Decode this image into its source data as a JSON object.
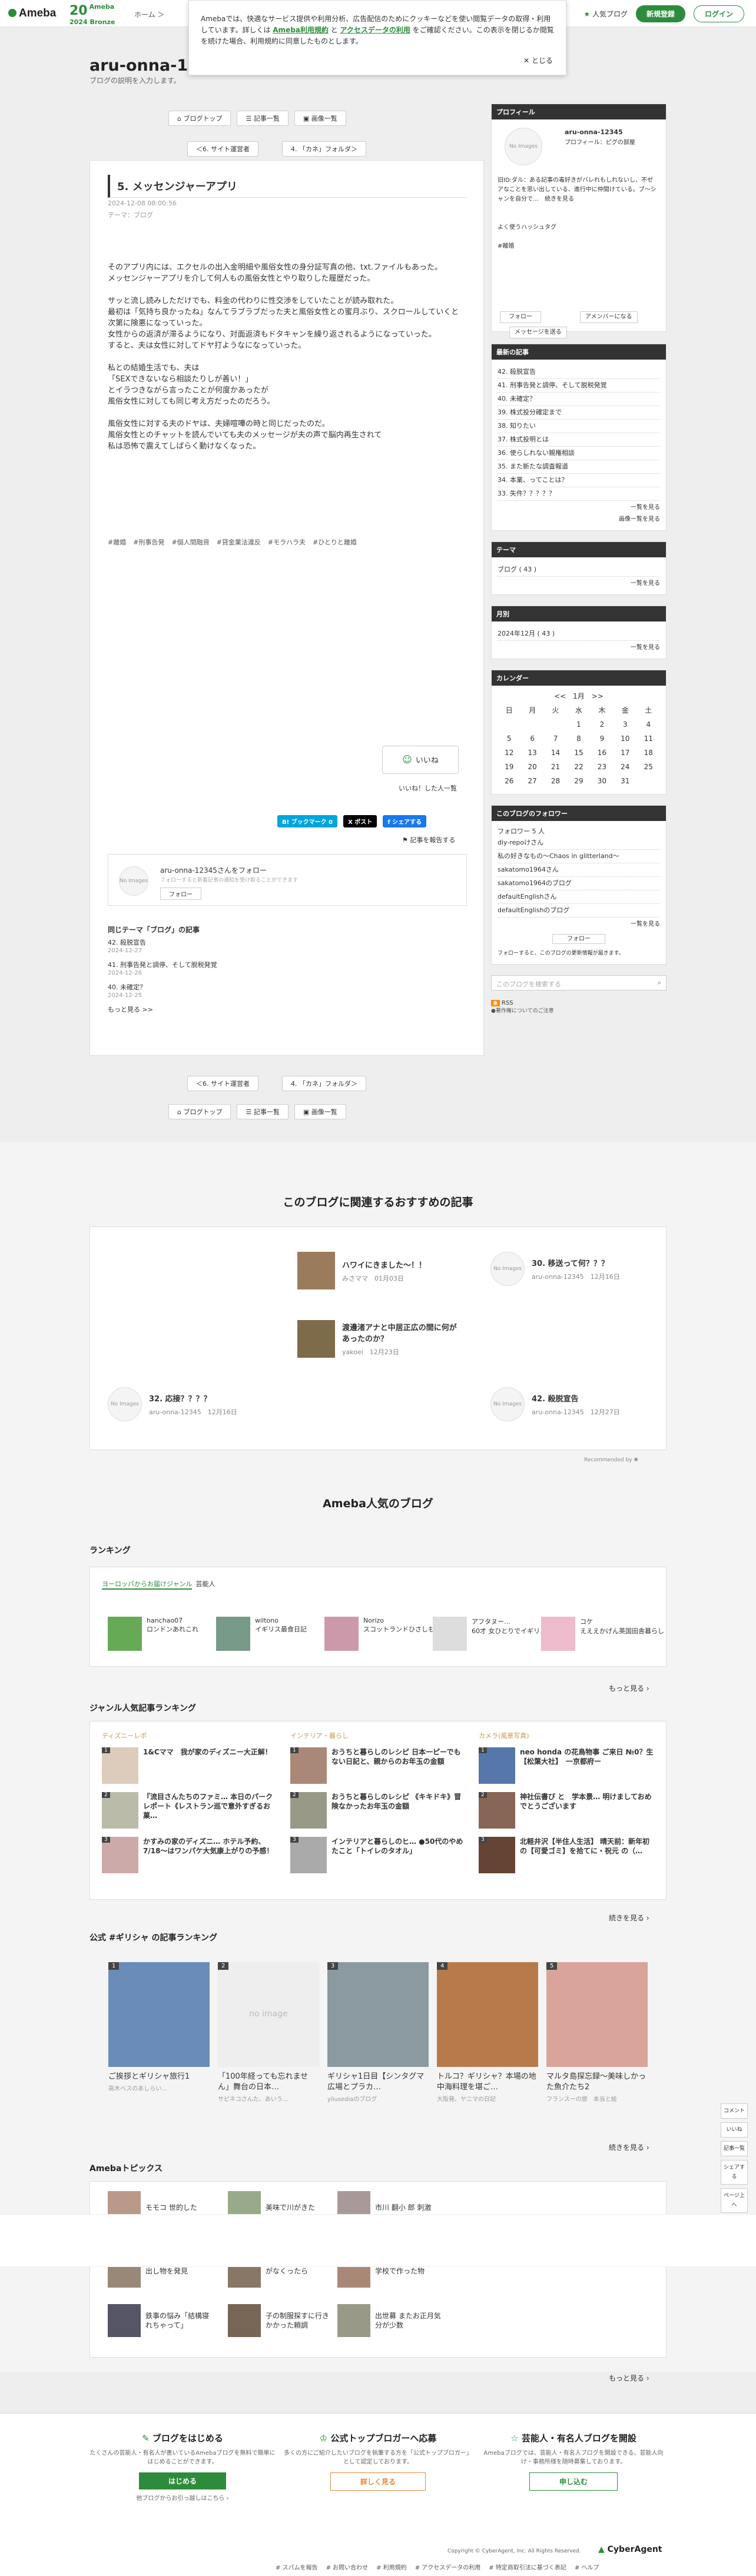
{
  "header": {
    "logo": "Ameba",
    "anniv_num": "20",
    "anniv_text": "Ameba\n2024 Bronze",
    "breadcrumb": "ホーム ＞",
    "popular": "人気ブログ",
    "signup": "新規登録",
    "login": "ログイン"
  },
  "cookie": {
    "text1": "Amebaでは、快適なサービス提供や利用分析、広告配信のためにクッキーなどを使い閲覧データの取得・利用しています。詳しくは ",
    "link1": "Ameba利用規約",
    "and": " と ",
    "link2": "アクセスデータの利用",
    "text2": " をご確認ください。この表示を閉じるか閲覧を続けた場合、利用規約に同意したものとします。",
    "close": "✕ とじる"
  },
  "blog": {
    "title": "aru-onna-12",
    "desc": "ブログの説明を入力します。"
  },
  "nav": {
    "top": "ブログトップ",
    "list": "記事一覧",
    "images": "画像一覧",
    "prev": "＜6. サイト運営者",
    "next": "4. 「カネ」フォルダ＞"
  },
  "entry": {
    "title": "5. メッセンジャーアプリ",
    "date": "2024-12-08 08:00:56",
    "theme": "テーマ：ブログ",
    "paras": [
      "そのアプリ内には、エクセルの出入金明細や風俗女性の身分証写真の他、txt.ファイルもあった。\nメッセンジャーアプリを介して何人もの風俗女性とやり取りした履歴だった。",
      "サッと流し読みしただけでも、料金の代わりに性交渉をしていたことが読み取れた。\n最初は「気持ち良かったね」なんてラブラブだった夫と風俗女性との蜜月ぶり、スクロールしていくと次第に険悪になっていった。\n女性からの返済が滞るようになり、対面返済もドタキャンを繰り返されるようになっていった。\nすると、夫は女性に対してドヤ打ようなになっていった。",
      "私との結婚生活でも、夫は\n「SEXできないなら相談たりしが善い！」\nとイラつきながら言ったことが何度かあったが\n風俗女性に対しても同じ考え方だったのだろう。",
      "風俗女性に対する夫のドヤは、夫婦喧嘩の時と同じだったのだ。\n風俗女性とのチャットを読んでいても夫のメッセージが夫の声で脳内再生されて\n私は恐怖で震えてしばらく動けなくなった。"
    ],
    "tags": [
      "#離婚",
      "#刑事告発",
      "#個人間融資",
      "#貸金業法違反",
      "#モラハラ夫",
      "#ひとりと離婚"
    ],
    "iine": "いいね",
    "iine_count": "いいね！した人一覧",
    "report": "記事を報告する",
    "share": {
      "hatena": "B! ブックマーク 0",
      "x": "X ポスト",
      "fb": "f シェアする"
    }
  },
  "follow": {
    "name": "aru-onna-12345さんをフォロー",
    "sub": "フォローすると新着記事の通知を受け取ることができます",
    "btn": "フォロー",
    "noimg": "No Images"
  },
  "same_theme": {
    "title": "同じテーマ「ブログ」の記事",
    "items": [
      {
        "t": "42. 殺脱宣告",
        "d": "2024-12-27"
      },
      {
        "t": "41. 刑事告発と調停、そして脱税発覚",
        "d": "2024-12-26"
      },
      {
        "t": "40. 未確定？",
        "d": "2024-12-25"
      }
    ],
    "more": "もっと見る >>"
  },
  "sidebar": {
    "profile": {
      "head": "プロフィール",
      "name": "aru-onna-12345",
      "sub": "プロフィール：ピグの部屋",
      "text": "旧ID:ダル：ある記事の毒好きがバレれもしれないし、不ゼアなことを思い出している、進行中に仲間けている。ブ～シャンを自分で…　続きを見る",
      "hashtag": "よく使うハッシュタグ",
      "tag": "#離婚",
      "follow": "フォロー",
      "member": "アメンバーになる",
      "message": "メッセージを送る"
    },
    "recent": {
      "head": "最新の記事",
      "items": [
        "42. 殺脱宣告",
        "41. 刑事告発と調停、そして脱税発覚",
        "40. 未確定？",
        "39. 株式投分確定まで",
        "38. 知りたい",
        "37. 株式投明とは",
        "36. 使らしれない親権相談",
        "35. また新たな調査報道",
        "34. 本業、ってことは？",
        "33. 失件？？？？？"
      ],
      "more": "一覧を見る",
      "img_more": "画像一覧を見る"
    },
    "theme": {
      "head": "テーマ",
      "item": "ブログ ( 43 )",
      "more": "一覧を見る"
    },
    "month": {
      "head": "月別",
      "item": "2024年12月 ( 43 )",
      "more": "一覧を見る"
    },
    "cal": {
      "head": "カレンダー",
      "nav": "<<　1月　>>",
      "days": [
        "日",
        "月",
        "火",
        "水",
        "木",
        "金",
        "土"
      ],
      "rows": [
        [
          "",
          "",
          "",
          "1",
          "2",
          "3",
          "4"
        ],
        [
          "5",
          "6",
          "7",
          "8",
          "9",
          "10",
          "11"
        ],
        [
          "12",
          "13",
          "14",
          "15",
          "16",
          "17",
          "18"
        ],
        [
          "19",
          "20",
          "21",
          "22",
          "23",
          "24",
          "25"
        ],
        [
          "26",
          "27",
          "28",
          "29",
          "30",
          "31",
          ""
        ]
      ]
    },
    "followers": {
      "head": "このブログのフォロワー",
      "count": "フォロワー 5 人",
      "items": [
        "diy-repoけさん",
        "私の好きなもの〜Chaos in glitterland〜",
        "sakatomo1964さん",
        "sakatomo1964のブログ",
        "defaultEnglishさん",
        "defaultEnglishのブログ"
      ],
      "more": "一覧を見る",
      "btn": "フォロー",
      "note": "フォローすると、このブログの更新情報が届きます。"
    },
    "search": "このブログを検索する",
    "rss": "RSS",
    "rss_note": "●著作権についてのご注意"
  },
  "recommend": {
    "title": "このブログに関連するおすすめの記事",
    "items": [
      {
        "t": "ハワイにきました〜！！",
        "m": "みさママ　01月03日"
      },
      {
        "t": "30. 移送って何？？？",
        "m": "aru-onna-12345　12月16日"
      },
      {
        "t": "渡邊渚アナと中居正広の間に何があったのか？",
        "m": "yakoei　12月23日"
      },
      {
        "t": "32. 応接？？？？",
        "m": "aru-onna-12345　12月16日"
      },
      {
        "t": "42. 殺脱宣告",
        "m": "aru-onna-12345　12月27日"
      }
    ],
    "by": "Recommended by"
  },
  "popular": {
    "title": "Ameba人気のブログ",
    "ranking": "ランキング",
    "genre_label": "ヨーロッパからお届けジャンル",
    "genre_tag": "芸能人",
    "rank": [
      {
        "n": "hanchao07",
        "t": "ロンドンあれこれ"
      },
      {
        "n": "wiltono",
        "t": "イギリス最食日記"
      },
      {
        "n": "Norizo",
        "t": "スコットランドひさしも日記"
      },
      {
        "n": "アフタヌー…",
        "t": "60才 女ひとりでイギリスに移住"
      },
      {
        "n": "コケ",
        "t": "えええかげん英国田舎暮らし"
      }
    ],
    "more": "もっと見る"
  },
  "genre": {
    "title": "ジャンル人気記事ランキング",
    "cols": [
      {
        "h": "ディズニーレポ",
        "items": [
          "1&Cママ　我が家のディズニー大正解！",
          "『流目さんたちのファミ… 本日のパークレポート《レストラン巡で意外すぎるお菓…",
          "かすみの家のディズニ… ホテル予約、7/18〜はワンパケ大気康上がりの予感！"
        ]
      },
      {
        "h": "インテリア・暮らし",
        "items": [
          "おうちと暮らしのレシピ 日本一ピーでもない日記と、親からのお年玉の金額",
          "おうちと暮らしのレシピ 《キキドキ》冒険なかったお年玉の金額",
          "インテリアと暮らしのヒ… ●50代のやめたこと「トイレのタオル」"
        ]
      },
      {
        "h": "カメラ(風景写真)",
        "items": [
          "neo honda の花鳥物事 ご来日 №0？生【松葉大社】　一京都府ー",
          "神社伝書び と　学本景… 明けましておめでとうございます",
          "北軽井沢【半住人生活】 晴天前：新年初の【可愛ゴミ】を拾てに・祝元 の（…"
        ]
      }
    ],
    "more": "続きを見る"
  },
  "official": {
    "title": "公式 #ギリシャ の記事ランキング",
    "cards": [
      {
        "t": "ご挨拶とギリシャ旅行1",
        "u": "高木ベスのあしらい..."
      },
      {
        "t": "「100年経っても忘れません」舞台の日本…",
        "u": "サビネコさんた、あいう..."
      },
      {
        "t": "ギリシャ1日目【シンタグマ広場とプラカ…",
        "u": "yliusediaのブログ"
      },
      {
        "t": "トルコ？ギリシャ？本場の地中海料理を堪ご…",
        "u": "大阪発、ヤニマの日記"
      },
      {
        "t": "マルタ島探忘録〜美味しかった魚介たち2",
        "u": "フランスーの旅　本当と絵"
      }
    ],
    "noimg": "no image",
    "more": "続きを見る"
  },
  "topics": {
    "title": "Amebaトピックス",
    "items": [
      "モモコ 世的した",
      "美味で川がきた",
      "市川 翻小 郎 刺激",
      "出し物を発見",
      "がなくったら",
      "学校で作った物",
      "鉄事の悩み「結構寝れちゃって」",
      "子の制服探すに行きかかった頼調",
      "出世募 またお正月気分が少数"
    ],
    "more": "もっと見る"
  },
  "footer": {
    "c1": {
      "t": "ブログをはじめる",
      "d": "たくさんの芸能人・有名人が書いているAmebaブログを無料で簡単にはじめることができます。",
      "b": "はじめる",
      "s": "他ブログからお引っ越しはこちら ›"
    },
    "c2": {
      "t": "公式トップブロガーへ応募",
      "d": "多くの方にご紹介したいブログを執筆する方を「公式トップブロガー」として認定しております。",
      "b": "詳しく見る"
    },
    "c3": {
      "t": "芸能人・有名人ブログを開設",
      "d": "Amebaブログでは、芸能人・有名人ブログを開設できる、芸能人向け・事務所様を随時募集しております。",
      "b": "申し込む"
    },
    "copy": "Copyright © CyberAgent, Inc. All Rights Reserved.",
    "ca": "CyberAgent",
    "links": [
      "# スパムを報告",
      "# お問い合わせ",
      "# 利用規約",
      "# アクセスデータの利用",
      "# 特定商取引法に基づく表記",
      "# ヘルプ"
    ]
  },
  "fixed": {
    "top": "ページ上へ",
    "comment": "コメント",
    "iine": "いいね",
    "menu": "記事一覧",
    "share": "シェアする"
  },
  "colors": {
    "brand": "#2d8c3c",
    "accent": "#4a8a3a"
  }
}
